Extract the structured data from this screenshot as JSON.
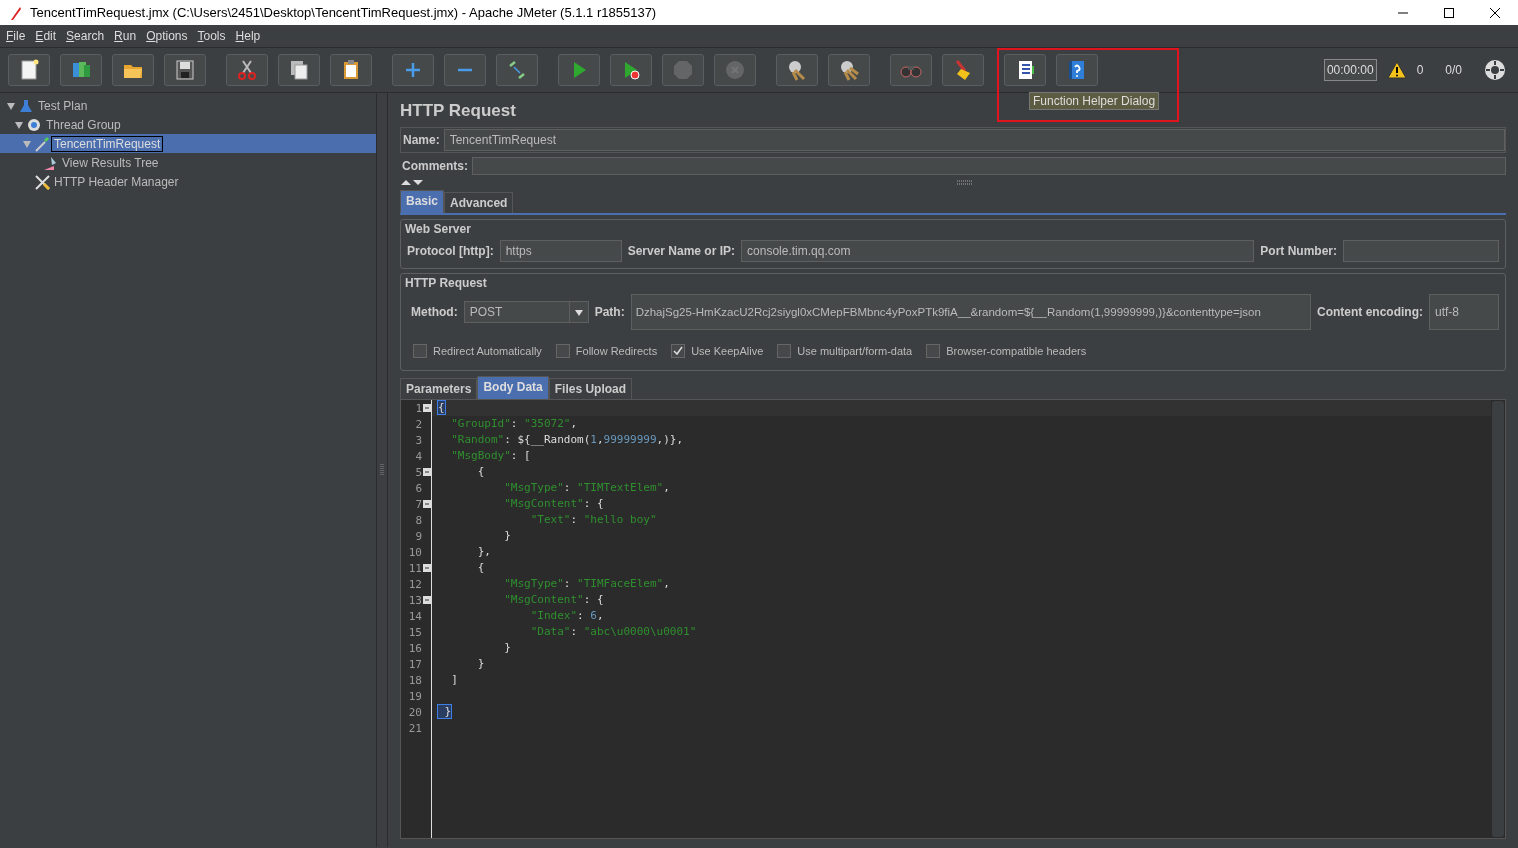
{
  "window": {
    "title": "TencentTimRequest.jmx (C:\\Users\\2451\\Desktop\\TencentTimRequest.jmx) - Apache JMeter (5.1.1 r1855137)"
  },
  "menu": [
    "File",
    "Edit",
    "Search",
    "Run",
    "Options",
    "Tools",
    "Help"
  ],
  "toolbar": {
    "groups": [
      [
        {
          "kind": "new",
          "disabled": false
        },
        {
          "kind": "templates",
          "disabled": false
        },
        {
          "kind": "open",
          "disabled": false
        },
        {
          "kind": "save",
          "disabled": false
        }
      ],
      [
        {
          "kind": "cut",
          "disabled": false
        },
        {
          "kind": "copy",
          "disabled": false
        },
        {
          "kind": "paste",
          "disabled": false
        }
      ],
      [
        {
          "kind": "expand",
          "disabled": false
        },
        {
          "kind": "collapse",
          "disabled": false
        },
        {
          "kind": "toggle",
          "disabled": false
        }
      ],
      [
        {
          "kind": "start",
          "disabled": false
        },
        {
          "kind": "start-no-pause",
          "disabled": false
        },
        {
          "kind": "stop",
          "disabled": true
        },
        {
          "kind": "shutdown",
          "disabled": true
        }
      ],
      [
        {
          "kind": "clear",
          "disabled": false
        },
        {
          "kind": "clear-all",
          "disabled": false
        }
      ],
      [
        {
          "kind": "search",
          "disabled": false
        },
        {
          "kind": "reset",
          "disabled": false
        }
      ],
      [
        {
          "kind": "function-helper",
          "disabled": false
        },
        {
          "kind": "help",
          "disabled": false
        }
      ]
    ],
    "tooltip": "Function Helper Dialog",
    "timer": "00:00:00",
    "warnings": "0",
    "threads": "0/0"
  },
  "tree": [
    {
      "label": "Test Plan",
      "kind": "plan",
      "selected": false,
      "expanded": true,
      "children": [
        {
          "label": "Thread Group",
          "kind": "group",
          "selected": false,
          "expanded": true,
          "children": [
            {
              "label": "TencentTimRequest",
              "kind": "sampler",
              "selected": true,
              "expanded": true,
              "children": [
                {
                  "label": "View Results Tree",
                  "kind": "listener",
                  "selected": false
                }
              ]
            },
            {
              "label": "HTTP Header Manager",
              "kind": "config",
              "selected": false
            }
          ]
        }
      ]
    }
  ],
  "panel": {
    "title": "HTTP Request",
    "name_label": "Name:",
    "name": "TencentTimRequest",
    "comments_label": "Comments:",
    "tabs": [
      {
        "label": "Basic",
        "selected": true
      },
      {
        "label": "Advanced",
        "selected": false
      }
    ],
    "web_server": {
      "legend": "Web Server",
      "protocol_label": "Protocol [http]:",
      "protocol": "https",
      "server_label": "Server Name or IP:",
      "server": "console.tim.qq.com",
      "port_label": "Port Number:"
    },
    "http_request": {
      "legend": "HTTP Request",
      "method_label": "Method:",
      "method": "POST",
      "path_label": "Path:",
      "path": "DzhajSg25-HmKzacU2Rcj2siygl0xCMepFBMbnc4yPoxPTk9fiA__&random=${__Random(1,99999999,)}&contenttype=json",
      "encoding_label": "Content encoding:",
      "encoding": "utf-8",
      "options": [
        {
          "label": "Redirect Automatically",
          "checked": false
        },
        {
          "label": "Follow Redirects",
          "checked": false
        },
        {
          "label": "Use KeepAlive",
          "checked": true
        },
        {
          "label": "Use multipart/form-data",
          "checked": false
        },
        {
          "label": "Browser-compatible headers",
          "checked": false
        }
      ]
    },
    "sub_tabs": [
      {
        "label": "Parameters",
        "selected": false
      },
      {
        "label": "Body Data",
        "selected": true
      },
      {
        "label": "Files Upload",
        "selected": false
      }
    ],
    "body": [
      {
        "number": "1",
        "fold": true,
        "tokens": [
          {
            "kind": "match",
            "text": "{"
          }
        ]
      },
      {
        "number": "2",
        "fold": false,
        "tokens": [
          {
            "kind": "key",
            "text": "  \"GroupId\""
          },
          {
            "kind": "punct",
            "text": ": "
          },
          {
            "kind": "str",
            "text": "\"35072\""
          },
          {
            "kind": "punct",
            "text": ","
          }
        ]
      },
      {
        "number": "3",
        "fold": false,
        "tokens": [
          {
            "kind": "key",
            "text": "  \"Random\""
          },
          {
            "kind": "punct",
            "text": ": ${__Random("
          },
          {
            "kind": "num",
            "text": "1"
          },
          {
            "kind": "punct",
            "text": ","
          },
          {
            "kind": "num",
            "text": "99999999"
          },
          {
            "kind": "punct",
            "text": ",)},"
          }
        ]
      },
      {
        "number": "4",
        "fold": false,
        "tokens": [
          {
            "kind": "key",
            "text": "  \"MsgBody\""
          },
          {
            "kind": "punct",
            "text": ": ["
          }
        ]
      },
      {
        "number": "5",
        "fold": true,
        "tokens": [
          {
            "kind": "punct",
            "text": "      {"
          }
        ]
      },
      {
        "number": "6",
        "fold": false,
        "tokens": [
          {
            "kind": "key",
            "text": "          \"MsgType\""
          },
          {
            "kind": "punct",
            "text": ": "
          },
          {
            "kind": "str",
            "text": "\"TIMTextElem\""
          },
          {
            "kind": "punct",
            "text": ","
          }
        ]
      },
      {
        "number": "7",
        "fold": true,
        "tokens": [
          {
            "kind": "key",
            "text": "          \"MsgContent\""
          },
          {
            "kind": "punct",
            "text": ": {"
          }
        ]
      },
      {
        "number": "8",
        "fold": false,
        "tokens": [
          {
            "kind": "key",
            "text": "              \"Text\""
          },
          {
            "kind": "punct",
            "text": ": "
          },
          {
            "kind": "str",
            "text": "\"hello boy\""
          }
        ]
      },
      {
        "number": "9",
        "fold": false,
        "tokens": [
          {
            "kind": "punct",
            "text": "          }"
          }
        ]
      },
      {
        "number": "10",
        "fold": false,
        "tokens": [
          {
            "kind": "punct",
            "text": "      },"
          }
        ]
      },
      {
        "number": "11",
        "fold": true,
        "tokens": [
          {
            "kind": "punct",
            "text": "      {"
          }
        ]
      },
      {
        "number": "12",
        "fold": false,
        "tokens": [
          {
            "kind": "key",
            "text": "          \"MsgType\""
          },
          {
            "kind": "punct",
            "text": ": "
          },
          {
            "kind": "str",
            "text": "\"TIMFaceElem\""
          },
          {
            "kind": "punct",
            "text": ","
          }
        ]
      },
      {
        "number": "13",
        "fold": true,
        "tokens": [
          {
            "kind": "key",
            "text": "          \"MsgContent\""
          },
          {
            "kind": "punct",
            "text": ": {"
          }
        ]
      },
      {
        "number": "14",
        "fold": false,
        "tokens": [
          {
            "kind": "key",
            "text": "              \"Index\""
          },
          {
            "kind": "punct",
            "text": ": "
          },
          {
            "kind": "num",
            "text": "6"
          },
          {
            "kind": "punct",
            "text": ","
          }
        ]
      },
      {
        "number": "15",
        "fold": false,
        "tokens": [
          {
            "kind": "key",
            "text": "              \"Data\""
          },
          {
            "kind": "punct",
            "text": ": "
          },
          {
            "kind": "str",
            "text": "\"abc\\u0000\\u0001\""
          }
        ]
      },
      {
        "number": "16",
        "fold": false,
        "tokens": [
          {
            "kind": "punct",
            "text": "          }"
          }
        ]
      },
      {
        "number": "17",
        "fold": false,
        "tokens": [
          {
            "kind": "punct",
            "text": "      }"
          }
        ]
      },
      {
        "number": "18",
        "fold": false,
        "tokens": [
          {
            "kind": "punct",
            "text": "  ]"
          }
        ]
      },
      {
        "number": "19",
        "fold": false
      },
      {
        "number": "20",
        "fold": false,
        "tokens": [
          {
            "kind": "match",
            "text": " }"
          }
        ]
      },
      {
        "number": "21",
        "fold": false
      }
    ]
  }
}
